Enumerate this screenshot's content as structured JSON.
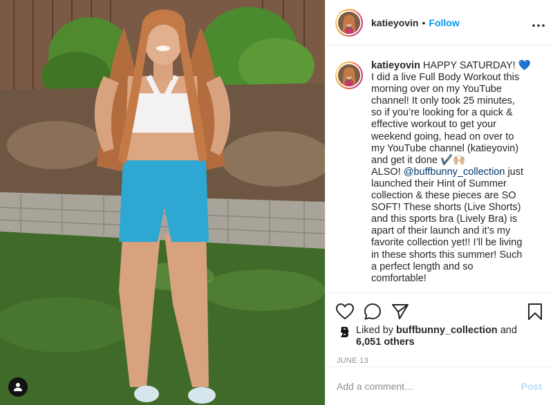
{
  "post": {
    "author": "katieyovin",
    "follow_label": "Follow",
    "separator": "•",
    "more_label": "•••",
    "photo_icon": "person-silhouette-icon",
    "caption_lines": [
      "I did a live Full Body Workout this",
      "morning over on my YouTube",
      "channel! It only took 25 minutes,",
      "so if you’re looking for a quick &",
      "effective workout to get your",
      "weekend going, head on over to",
      "my YouTube channel (katieyovin)",
      "and get it done ✔️🙌🏼"
    ],
    "caption_first": "HAPPY SATURDAY! 💙",
    "caption_also": "ALSO!",
    "caption_mention": "@buffbunny_collection",
    "caption_after_mention": "just",
    "caption_lines_2": [
      "launched their Hint of Summer",
      "collection & these pieces are SO",
      "SOFT! These shorts (Live Shorts)",
      "and this sports bra (Lively Bra) is",
      "apart of their launch and it’s my",
      "favorite collection yet!! I’ll be living",
      "in these shorts this summer! Such",
      "a perfect length and so",
      "comfortable!"
    ],
    "likes_prefix": "Liked by",
    "likes_user": "buffbunny_collection",
    "likes_and": "and",
    "likes_others": "6,051 others",
    "date": "JUNE 13",
    "comment_placeholder": "Add a comment…",
    "post_label": "Post",
    "colors": {
      "accent": "#0095f6",
      "post_disabled": "#b2dffc",
      "muted": "#8e8e8e"
    }
  },
  "icons": {
    "like": "heart-icon",
    "comment": "comment-bubble-icon",
    "share": "paper-plane-icon",
    "save": "bookmark-icon",
    "likes_logo": "buffbunny-logo-icon"
  }
}
